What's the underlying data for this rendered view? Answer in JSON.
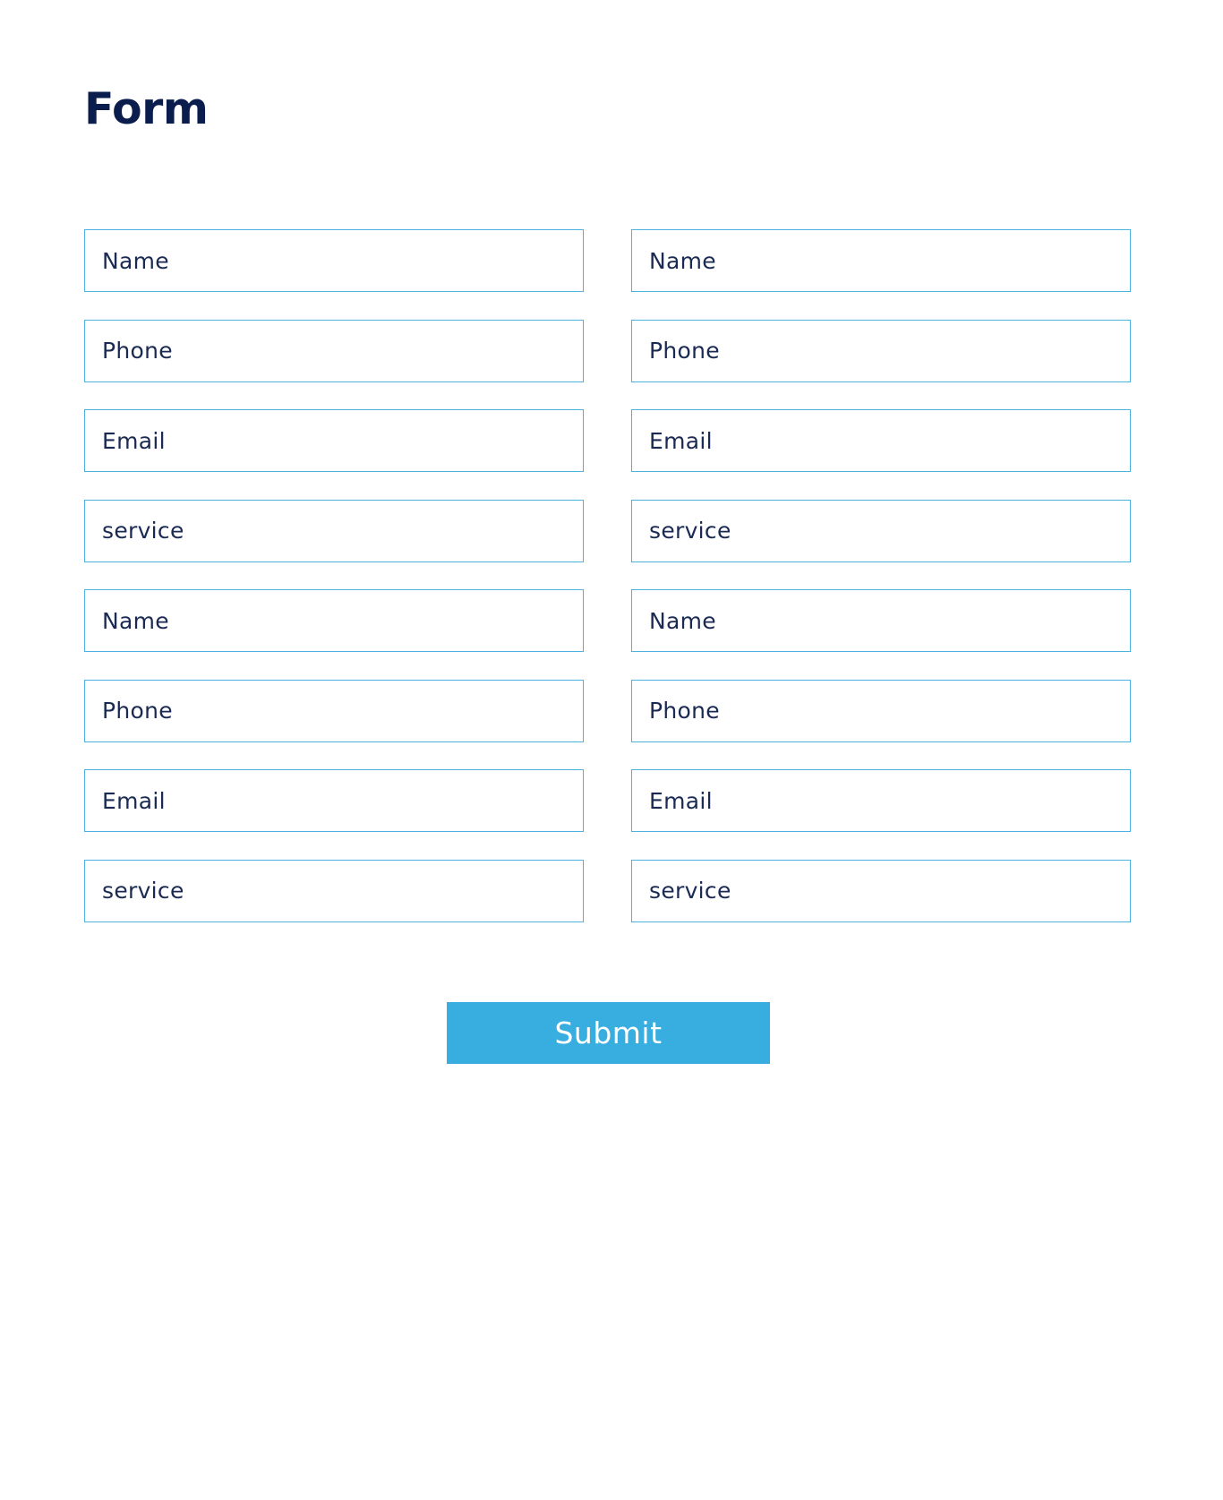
{
  "form": {
    "title": "Form",
    "fields": [
      {
        "placeholder": "Name"
      },
      {
        "placeholder": "Name"
      },
      {
        "placeholder": "Phone"
      },
      {
        "placeholder": "Phone"
      },
      {
        "placeholder": "Email"
      },
      {
        "placeholder": "Email"
      },
      {
        "placeholder": "service"
      },
      {
        "placeholder": "service"
      },
      {
        "placeholder": "Name"
      },
      {
        "placeholder": "Name"
      },
      {
        "placeholder": "Phone"
      },
      {
        "placeholder": "Phone"
      },
      {
        "placeholder": "Email"
      },
      {
        "placeholder": "Email"
      },
      {
        "placeholder": "service"
      },
      {
        "placeholder": "service"
      }
    ],
    "submit_label": "Submit"
  },
  "colors": {
    "title": "#0a1d4d",
    "field_border": "#4bb4de",
    "field_text": "#1a2a52",
    "button_bg": "#38aee0",
    "button_text": "#ffffff"
  }
}
